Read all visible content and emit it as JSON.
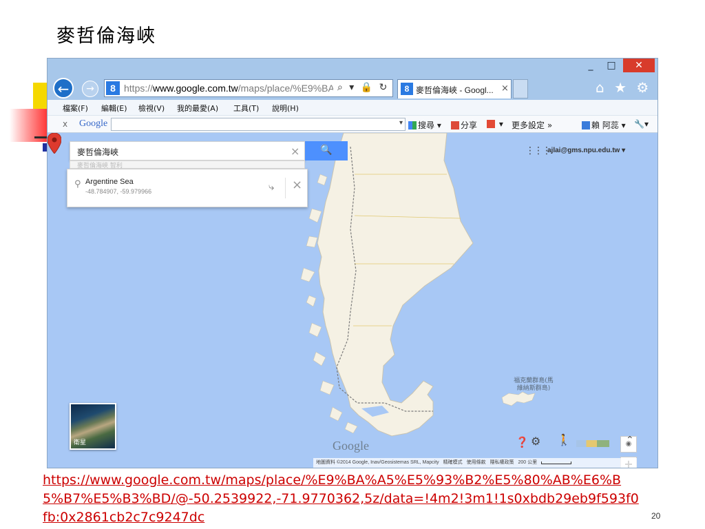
{
  "slide": {
    "title": "麥哲倫海峽",
    "page_number": "20",
    "link": "https://www.google.com.tw/maps/place/%E9%BA%A5%E5%93%B2%E5%80%AB%E6%B5%B7%E5%B3%BD/@-50.2539922,-71.9770362,5z/data=!4m2!3m1!1s0xbdb29eb9f593f0fb:0x2861cb2c7c9247dc",
    "colors": {
      "link": "#cc0000",
      "deco_yellow": "#f5d800",
      "deco_red": "#ff2a2a"
    }
  },
  "window": {
    "minimize": "_",
    "maximize": "□",
    "close": "✕"
  },
  "browser": {
    "back_icon": "arrow-left-icon",
    "back_glyph": "←",
    "forward_glyph": "→",
    "favicon": "8",
    "url_prefix": "https://",
    "url_host": "www.google.com.tw",
    "url_path": "/maps/place/%E9%BA%A5",
    "addr_search": "⌕",
    "addr_dropdown": "▾",
    "addr_lock": "🔒",
    "addr_refresh": "↻",
    "tab": {
      "favicon": "8",
      "title": "麥哲倫海峽 - Googl...",
      "close": "×"
    },
    "home_glyph": "⌂",
    "favorites_glyph": "★",
    "settings_glyph": "⚙",
    "colors": {
      "chrome": "#a7c7ea",
      "back": "#1e6fc8",
      "close": "#d83b2b"
    }
  },
  "menu": {
    "items": [
      "檔案(F)",
      "編輯(E)",
      "檢視(V)",
      "我的最愛(A)",
      "工具(T)",
      "說明(H)"
    ]
  },
  "toolbar": {
    "close": "x",
    "logo": "Google",
    "search_dropdown": "▾",
    "search_btn": "搜尋",
    "share_btn": "分享",
    "more_settings": "更多設定 »",
    "user": "賴 阿蕊",
    "wrench": "🔧",
    "dropdown": "▾"
  },
  "map": {
    "search": {
      "query": "麥哲倫海峽",
      "clear": "×",
      "button_glyph": "🔍",
      "suggestion_peek": "麥哲倫海峽 智利"
    },
    "card": {
      "name": "Argentine Sea",
      "coords": "-48.784907, -59.979966",
      "directions_glyph": "⤷",
      "close": "×"
    },
    "apps_glyph": "⋮⋮⋮",
    "account": "ajlai@gms.npu.edu.tw ▾",
    "falkland_label": "福克蘭群島(馬維納斯群島)",
    "zoom": {
      "locate": "◉",
      "in": "+",
      "out": "−"
    },
    "satellite_label": "衛星",
    "watermark": "Google",
    "help_glyph": "❓",
    "gear_glyph": "⚙",
    "pegman_glyph": "🚶",
    "expand_glyph": "⌃",
    "attribution": {
      "data": "地圖資料 ©2014 Google, Inav/Geosistemas SRL, Mapcity",
      "report": "精確模式",
      "terms": "使用條款",
      "privacy": "隱私權政策",
      "scale": "200 公里"
    },
    "colors": {
      "water": "#a8c8f5",
      "land": "#f5f1e4",
      "pin": "#dd3a2e"
    }
  }
}
